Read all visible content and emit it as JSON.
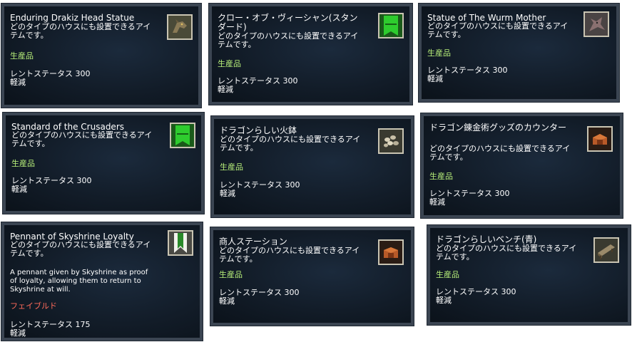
{
  "tooltips": [
    {
      "title": "Enduring Drakiz Head Statue",
      "description": "どのタイプのハウスにも設置できるアイ\nテムです。",
      "tag": "生産品",
      "stat": "レントステータス 300\n軽減",
      "icon": "dragon-head-statue-icon"
    },
    {
      "title": "クロー・オブ・ヴィーシャン(スタン\nダード)",
      "description": "どのタイプのハウスにも設置できるアイ\nテムです。",
      "tag": "生産品",
      "stat": "レントステータス 300\n軽減",
      "icon": "green-banner-icon"
    },
    {
      "title": "Statue of The Wurm Mother",
      "description": "どのタイプのハウスにも設置できるアイ\nテムです。",
      "tag": "生産品",
      "stat": "レントステータス 300\n軽減",
      "icon": "wurm-statue-icon"
    },
    {
      "title": "Standard of the Crusaders",
      "description": "どのタイプのハウスにも設置できるアイ\nテムです。",
      "tag": "生産品",
      "stat": "レントステータス 300\n軽減",
      "icon": "green-banner-icon"
    },
    {
      "title": "ドラゴンらしい火鉢",
      "description": "どのタイプのハウスにも設置できるアイ\nテムです。",
      "tag": "生産品",
      "stat": "レントステータス 300\n軽減",
      "icon": "brazier-icon"
    },
    {
      "title": "ドラゴン錬金術グッズのカウンター",
      "description": "どのタイプのハウスにも設置できるアイ\nテムです。",
      "tag": "生産品",
      "stat": "レントステータス 300\n軽減",
      "icon": "counter-icon"
    },
    {
      "title": "Pennant of Skyshrine Loyalty",
      "description": "どのタイプのハウスにも設置できるアイ\nテムです。",
      "lore": "A pennant given by Skyshrine as proof\nof loyalty, allowing them to return to\nSkyshrine at will.",
      "tag": "フェイブルド",
      "stat": "レントステータス 175\n軽減",
      "icon": "pennant-icon"
    },
    {
      "title": "商人ステーション",
      "description": "どのタイプのハウスにも設置できるアイ\nテムです。",
      "tag": "生産品",
      "stat": "レントステータス 300\n軽減",
      "icon": "merchant-station-icon"
    },
    {
      "title": "ドラゴンらしいベンチ(青)",
      "description": "どのタイプのハウスにも設置できるアイ\nテムです。",
      "tag": "生産品",
      "stat": "レントステータス 300\n軽減",
      "icon": "bench-icon"
    }
  ],
  "colors": {
    "produced_tag": "#b8f07a",
    "fabled_tag": "#ff6a5a",
    "panel_border": "#3b4552",
    "panel_bg": "#121c28"
  }
}
